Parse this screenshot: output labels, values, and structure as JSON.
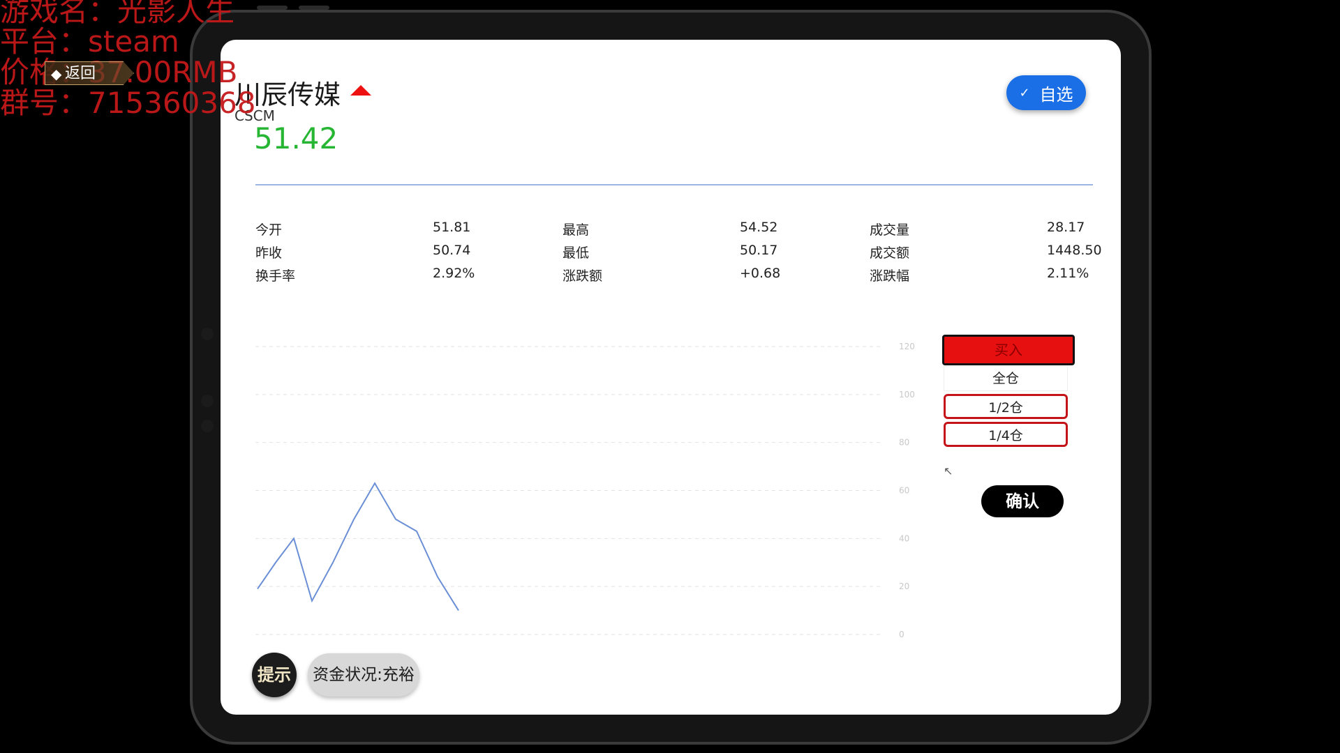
{
  "overlay": {
    "line1": "游戏名：光影人生",
    "line2": "平台：steam",
    "line3": "价格：37.00RMB",
    "line4": "群号：715360368"
  },
  "back_button": {
    "label": "返回"
  },
  "stock": {
    "name": "川辰传媒",
    "code": "CSCM",
    "price": "51.42",
    "trend": "up"
  },
  "favorite_button": {
    "label": "自选"
  },
  "stats": [
    {
      "label": "今开",
      "value": "51.81",
      "label2": "最高",
      "value2": "54.52",
      "label3": "成交量",
      "value3": "28.17"
    },
    {
      "label": "昨收",
      "value": "50.74",
      "label2": "最低",
      "value2": "50.17",
      "label3": "成交额",
      "value3": "1448.50"
    },
    {
      "label": "换手率",
      "value": "2.92%",
      "label2": "涨跌额",
      "value2": "+0.68",
      "label3": "涨跌幅",
      "value3": "2.11%"
    }
  ],
  "trade": {
    "buy_label": "买入",
    "options": [
      "全仓",
      "1/2仓",
      "1/4仓"
    ],
    "confirm_label": "确认"
  },
  "bottom": {
    "hint_label": "提示",
    "funds_status": "资金状况:充裕"
  },
  "colors": {
    "price_green": "#27b634",
    "up_red": "#e11111",
    "accent_blue": "#1a6fe6",
    "line_color": "#6b8fd6"
  },
  "chart_data": {
    "type": "line",
    "x": [
      0,
      1,
      2,
      3,
      4,
      5,
      6,
      7,
      8,
      9,
      10
    ],
    "series": [
      {
        "values": [
          19,
          30,
          40,
          14,
          30,
          48,
          63,
          48,
          43,
          24,
          10
        ]
      }
    ],
    "ylim": [
      0,
      120
    ],
    "yticks": [
      0,
      20,
      40,
      60,
      80,
      100,
      120
    ],
    "xlabel": "",
    "ylabel": "",
    "grid": true
  }
}
